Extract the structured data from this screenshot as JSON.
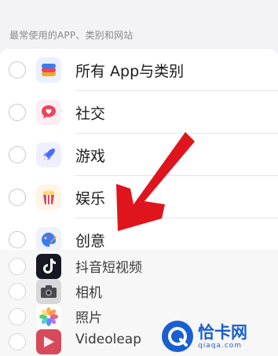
{
  "section": {
    "header": "最常使用的APP、类别和网站"
  },
  "rows": [
    {
      "label": "所有 App与类别",
      "icon": "stack-layers-icon"
    },
    {
      "label": "社交",
      "icon": "chat-heart-icon"
    },
    {
      "label": "游戏",
      "icon": "rocket-icon"
    },
    {
      "label": "娱乐",
      "icon": "popcorn-icon"
    },
    {
      "label": "创意",
      "icon": "palette-brush-icon"
    }
  ],
  "apps": [
    {
      "label": "抖音短视频",
      "icon": "tiktok-icon"
    },
    {
      "label": "相机",
      "icon": "camera-icon"
    },
    {
      "label": "照片",
      "icon": "photos-flower-icon"
    },
    {
      "label": "Videoleap",
      "icon": "videoleap-icon"
    }
  ],
  "watermark": {
    "title": "恰卡网",
    "url": "qiaqa.com"
  },
  "colors": {
    "background": "#f2f2f7",
    "card": "#ffffff",
    "annotation_arrow": "#e0141c",
    "watermark": "#1a5fd1"
  }
}
